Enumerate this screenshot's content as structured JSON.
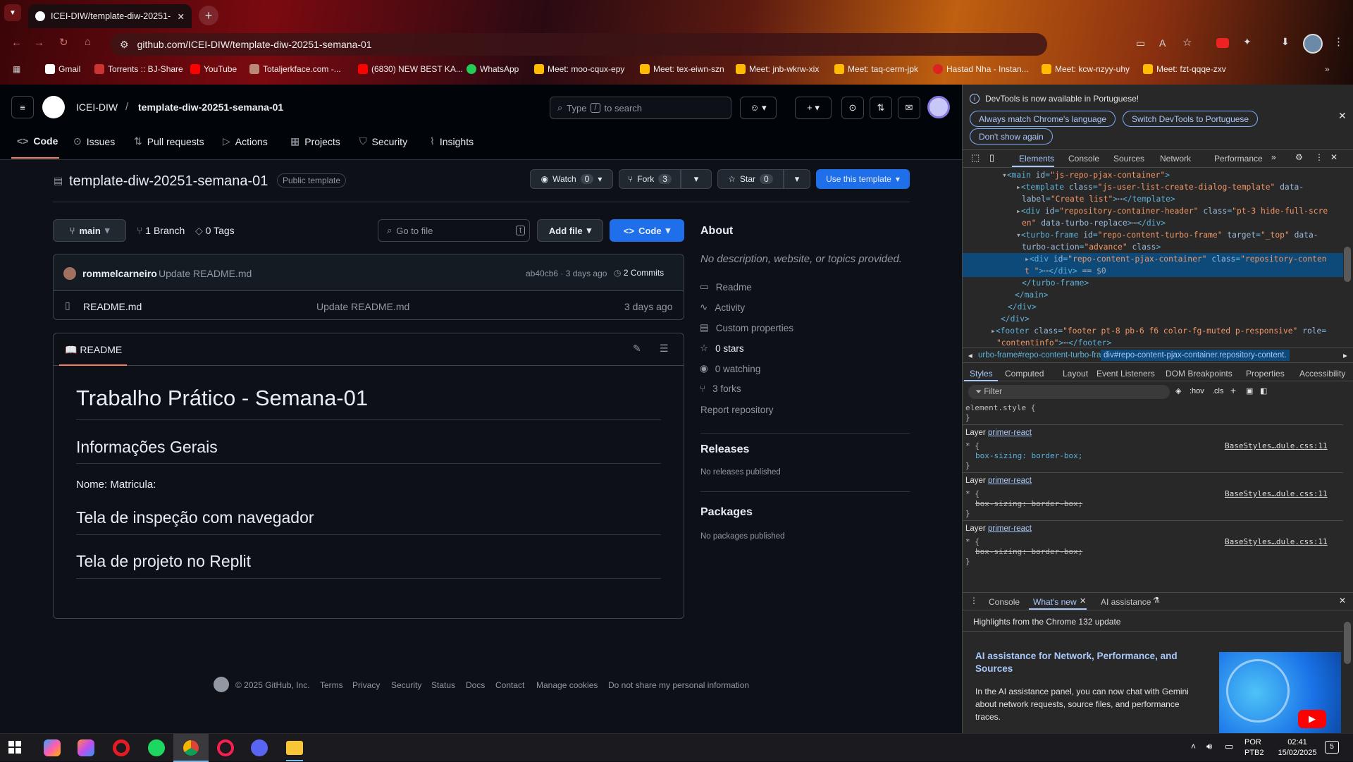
{
  "browser": {
    "tab_title": "ICEI-DIW/template-diw-20251-",
    "url": "github.com/ICEI-DIW/template-diw-20251-semana-01",
    "bookmarks": [
      "Gmail",
      "Torrents :: BJ-Share",
      "YouTube",
      "Totaljerkface.com -...",
      "(6830) NEW BEST KA...",
      "WhatsApp",
      "Meet: moo-cqux-epy",
      "Meet: tex-eiwn-szn",
      "Meet: jnb-wkrw-xix",
      "Meet: taq-cerm-jpk",
      "Hastad Nha - Instan...",
      "Meet: kcw-nzyy-uhy",
      "Meet: fzt-qqqe-zxv"
    ]
  },
  "github": {
    "org": "ICEI-DIW",
    "repo": "template-diw-20251-semana-01",
    "search_placeholder_pre": "Type",
    "search_key": "/",
    "search_placeholder_post": "to search",
    "nav": [
      "Code",
      "Issues",
      "Pull requests",
      "Actions",
      "Projects",
      "Security",
      "Insights"
    ],
    "repo_title": "template-diw-20251-semana-01",
    "repo_badge": "Public template",
    "watch_label": "Watch",
    "watch_count": "0",
    "fork_label": "Fork",
    "fork_count": "3",
    "star_label": "Star",
    "star_count": "0",
    "use_template": "Use this template",
    "branch": "main",
    "branches": "1 Branch",
    "tags": "0 Tags",
    "goto_file": "Go to file",
    "goto_key": "t",
    "add_file": "Add file",
    "code_btn": "Code",
    "commit_author": "rommelcarneiro",
    "commit_msg": "Update README.md",
    "commit_hash": "ab40cb6 · 3 days ago",
    "commits": "2 Commits",
    "file_name": "README.md",
    "file_msg": "Update README.md",
    "file_time": "3 days ago",
    "readme_tab": "README",
    "readme": {
      "h1": "Trabalho Prático - Semana-01",
      "h2a": "Informações Gerais",
      "p1": "Nome: Matricula:",
      "h2b": "Tela de inspeção com navegador",
      "h2c": "Tela de projeto no Replit"
    },
    "about": {
      "title": "About",
      "desc": "No description, website, or topics provided.",
      "items": [
        "Readme",
        "Activity",
        "Custom properties",
        "0 stars",
        "0 watching",
        "3 forks"
      ],
      "report": "Report repository",
      "releases_title": "Releases",
      "releases_text": "No releases published",
      "packages_title": "Packages",
      "packages_text": "No packages published"
    },
    "footer": [
      "© 2025 GitHub, Inc.",
      "Terms",
      "Privacy",
      "Security",
      "Status",
      "Docs",
      "Contact",
      "Manage cookies",
      "Do not share my personal information"
    ]
  },
  "devtools": {
    "notice": "DevTools is now available in Portuguese!",
    "btn1": "Always match Chrome's language",
    "btn2": "Switch DevTools to Portuguese",
    "btn3": "Don't show again",
    "tabs": [
      "Elements",
      "Console",
      "Sources",
      "Network",
      "Performance"
    ],
    "crumb1": "urbo-frame#repo-content-turbo-frame",
    "crumb2": "div#repo-content-pjax-container.repository-content.",
    "style_tabs": [
      "Styles",
      "Computed",
      "Layout",
      "Event Listeners",
      "DOM Breakpoints",
      "Properties",
      "Accessibility"
    ],
    "filter": "Filter",
    "hov": ":hov",
    "cls": ".cls",
    "element_style": "element.style {",
    "layer": "Layer",
    "layer_link": "primer-react",
    "rule_src": "BaseStyles…dule.css:11",
    "prop": "box-sizing: border-box;",
    "drawer_tabs": [
      "Console",
      "What's new",
      "AI assistance"
    ],
    "highlights": "Highlights from the Chrome 132 update",
    "ai_title": "AI assistance for Network, Performance, and Sources",
    "ai_text": "In the AI assistance panel, you can now chat with Gemini about network requests, source files, and performance traces."
  },
  "taskbar": {
    "lang1": "POR",
    "lang2": "PTB2",
    "time": "02:41",
    "date": "15/02/2025",
    "notif": "5"
  }
}
